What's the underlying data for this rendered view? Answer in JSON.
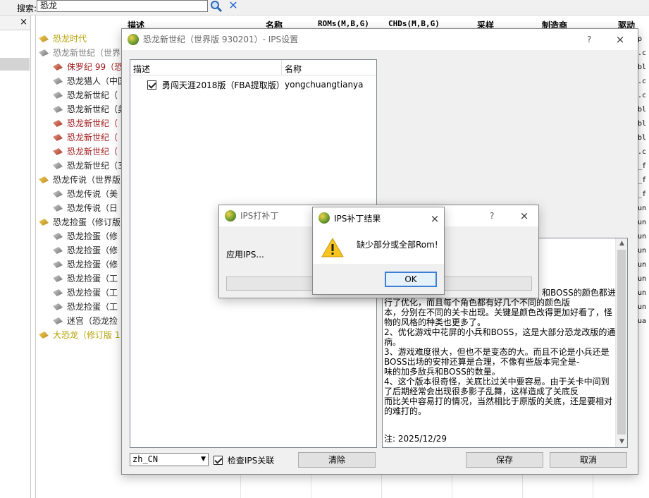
{
  "toolbar": {
    "search_label": "搜索:",
    "search_value": "恐龙",
    "search_icon": "search-icon",
    "clear_icon": "clear-icon"
  },
  "left_pane": {
    "close_label": "×"
  },
  "columns": {
    "desc": "描述",
    "name": "名称",
    "roms": "ROMs(M,B,G)",
    "chds": "CHDs(M,B,G)",
    "sample": "采样",
    "manufacturer": "制造商",
    "driver": "驱动"
  },
  "tree": [
    {
      "label": "恐龙时代",
      "color": "#b5a000",
      "icon": "yellow"
    },
    {
      "label": "恐龙新世纪（世界",
      "color": "#7a7a7a",
      "icon": "gray"
    },
    {
      "label": "侏罗纪 99（恐",
      "color": "#a11a1a",
      "icon": "red"
    },
    {
      "label": "恐龙猎人（中国",
      "color": "#222222",
      "icon": "gray"
    },
    {
      "label": "恐龙新世纪（",
      "color": "#222222",
      "icon": "gray"
    },
    {
      "label": "恐龙新世纪（美",
      "color": "#222222",
      "icon": "gray"
    },
    {
      "label": "恐龙新世纪（",
      "color": "#a11a1a",
      "icon": "red"
    },
    {
      "label": "恐龙新世纪（",
      "color": "#a11a1a",
      "icon": "red"
    },
    {
      "label": "恐龙新世纪（",
      "color": "#a11a1a",
      "icon": "red"
    },
    {
      "label": "恐龙新世纪（3",
      "color": "#222222",
      "icon": "gray"
    },
    {
      "label": "恐龙传说（世界版",
      "color": "#222222",
      "icon": "yellow"
    },
    {
      "label": "恐龙传说（美",
      "color": "#222222",
      "icon": "gray"
    },
    {
      "label": "恐龙传说（日",
      "color": "#222222",
      "icon": "gray"
    },
    {
      "label": "恐龙捡蛋（修订版",
      "color": "#222222",
      "icon": "yellow"
    },
    {
      "label": "恐龙捡蛋（修",
      "color": "#222222",
      "icon": "gray"
    },
    {
      "label": "恐龙捡蛋（修",
      "color": "#222222",
      "icon": "gray"
    },
    {
      "label": "恐龙捡蛋（修",
      "color": "#222222",
      "icon": "gray"
    },
    {
      "label": "恐龙捡蛋（工",
      "color": "#222222",
      "icon": "gray"
    },
    {
      "label": "恐龙捡蛋（工",
      "color": "#222222",
      "icon": "gray"
    },
    {
      "label": "恐龙捡蛋（工",
      "color": "#222222",
      "icon": "gray"
    },
    {
      "label": "迷宫（恐龙捡",
      "color": "#222222",
      "icon": "gray"
    },
    {
      "label": "大恐龙（修订版 1",
      "color": "#b5a000",
      "icon": "yellow"
    }
  ],
  "right_col": [
    "pp",
    "1.c",
    "1bl",
    "1.c",
    "1.c",
    "1bl",
    "1bl",
    "1bl",
    "1.c",
    "o_f",
    "o_f",
    "o_f",
    "yun",
    "yun",
    "yun",
    "yun",
    "yun",
    "yun",
    "yun",
    "yun",
    "qua"
  ],
  "ips_dialog": {
    "title": "恐龙新世纪（世界版 930201）- IPS设置",
    "help": "?",
    "close": "×",
    "list_header_desc": "描述",
    "list_header_name": "名称",
    "patches": [
      {
        "desc": "勇闯天涯2018版（FBA提取版）",
        "name": "yongchuangtianya",
        "checked": true
      }
    ],
    "description_lines": [
      "和BOSS的颜色都进",
      "行了优化，而且每个角色都有好几个不同的颜色版",
      "本，分别在不同的关卡出现。关键是颜色改得更加好看了，怪",
      "物的风格的种类也更多了。",
      "2、优化游戏中花屏的小兵和BOSS，这是大部分恐龙改版的通",
      "病。",
      "3、游戏难度很大，但也不是变态的大。而且不论是小兵还是",
      "BOSS出场的安排还算是合理，不像有些版本完全是-",
      "味的加多敌兵和BOSS的数量。",
      "4、这个版本很奇怪，关底比过关中要容易。由于关卡中间到",
      "了后期经常会出现很多影子乱舞，这样造成了关底反",
      "而比关中容易打的情况，当然相比于原版的关底，还是要相对",
      "的难打的。"
    ],
    "note_date": "注: 2025/12/29",
    "language": "zh_CN",
    "check_ips_label": "检查IPS关联",
    "check_ips_checked": true,
    "clear_button": "清除",
    "save_button": "保存",
    "cancel_button": "取消"
  },
  "patch_dialog": {
    "title": "IPS打补丁",
    "status": "应用IPS...",
    "help": "?",
    "close": "×"
  },
  "result_dialog": {
    "title": "IPS补丁结果",
    "message": "缺少部分或全部Rom!",
    "ok_button": "OK",
    "close": "×",
    "icon": "warning-icon"
  }
}
